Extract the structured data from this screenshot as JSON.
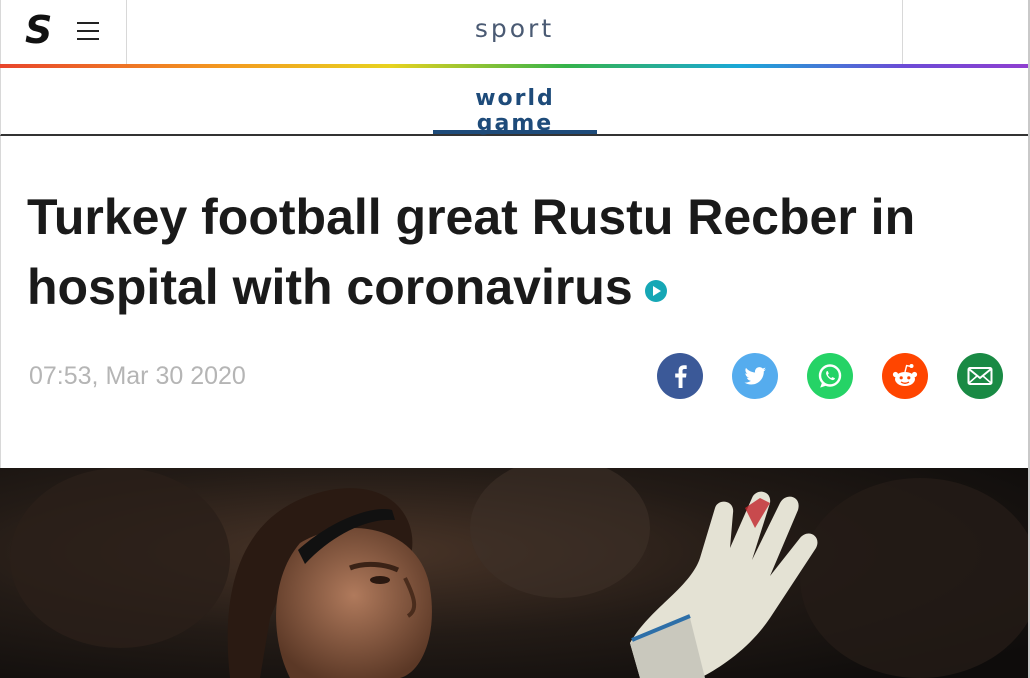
{
  "header": {
    "logo": "S",
    "section": "sport"
  },
  "subnav": {
    "tab_label": "world game"
  },
  "article": {
    "headline": "Turkey football great Rustu Recber in hospital with coronavirus",
    "timestamp": "07:53, Mar 30 2020"
  },
  "share": [
    {
      "name": "facebook",
      "icon": "facebook-icon",
      "color": "#3b5998"
    },
    {
      "name": "twitter",
      "icon": "twitter-icon",
      "color": "#55acee"
    },
    {
      "name": "whatsapp",
      "icon": "whatsapp-icon",
      "color": "#25d366"
    },
    {
      "name": "reddit",
      "icon": "reddit-icon",
      "color": "#ff4500"
    },
    {
      "name": "email",
      "icon": "email-icon",
      "color": "#198a44"
    }
  ],
  "colors": {
    "accent": "#1e4b7a",
    "video_badge": "#16a7b5",
    "timestamp": "#b5b5b5"
  }
}
